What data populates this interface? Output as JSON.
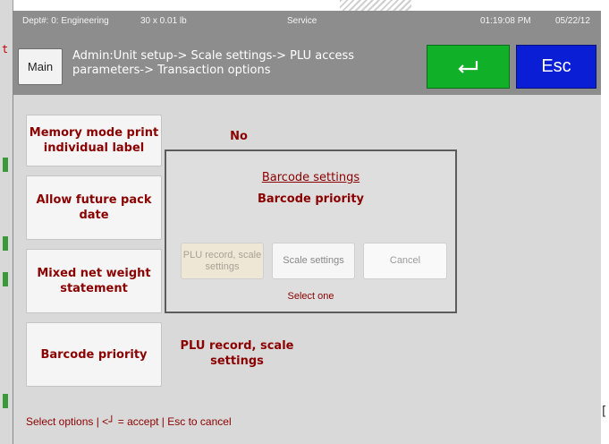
{
  "background": {
    "left_mark": "t"
  },
  "status": {
    "dept": "Dept#: 0: Engineering",
    "tare": "30 x 0.01 lb",
    "mode": "Service",
    "time": "01:19:08 PM",
    "date": "05/22/12"
  },
  "header": {
    "main_label": "Main",
    "breadcrumb": "Admin:Unit setup-> Scale settings-> PLU access parameters-> Transaction options",
    "enter_icon": "enter-return-icon",
    "esc_label": "Esc"
  },
  "options": [
    {
      "label": "Memory mode print individual label",
      "value": "No"
    },
    {
      "label": "Allow future pack date",
      "value": ""
    },
    {
      "label": "Mixed net weight statement",
      "value": ""
    },
    {
      "label": "Barcode priority",
      "value": "PLU record, scale settings"
    }
  ],
  "dialog": {
    "title": "Barcode settings",
    "subtitle": "Barcode priority",
    "buttons": {
      "plu": "PLU record, scale settings",
      "scale": "Scale settings",
      "cancel": "Cancel"
    },
    "hint": "Select one"
  },
  "footer": {
    "prefix": "Select options | <",
    "enter_glyph": "┘",
    "suffix": " = accept | Esc to cancel"
  },
  "colors": {
    "header_bg": "#8d8d8d",
    "enter_green": "#10b028",
    "esc_blue": "#0a1ed6",
    "text_dark_red": "#8b0000",
    "panel_bg": "#d9d9d9"
  }
}
